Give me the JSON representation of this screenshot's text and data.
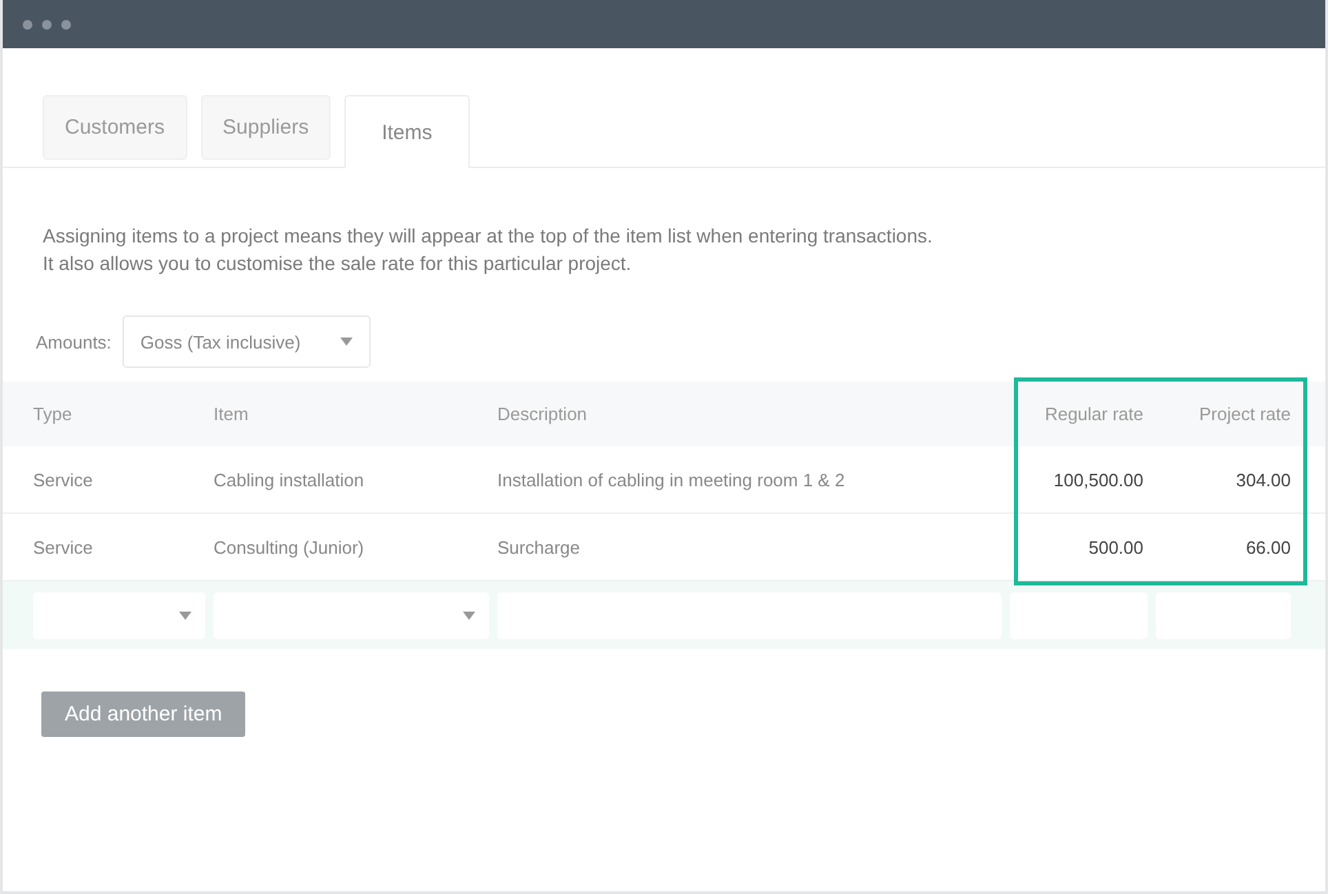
{
  "tabs": [
    {
      "label": "Customers",
      "selected": false
    },
    {
      "label": "Suppliers",
      "selected": false
    },
    {
      "label": "Items",
      "selected": true
    }
  ],
  "intro": [
    "Assigning items to a project means they will appear at the top of the item list when entering transactions.",
    "It also allows you to customise the sale rate for this particular project."
  ],
  "amounts": {
    "label": "Amounts:",
    "value": "Goss (Tax inclusive)"
  },
  "table": {
    "columns": [
      {
        "label": "Type",
        "kind": "select",
        "highlighted": false
      },
      {
        "label": "Item",
        "kind": "select",
        "highlighted": false
      },
      {
        "label": "Description",
        "kind": "text",
        "highlighted": false
      },
      {
        "label": "Regular rate",
        "kind": "amount",
        "highlighted": true
      },
      {
        "label": "Project rate",
        "kind": "amount",
        "highlighted": true
      }
    ],
    "rows": [
      [
        "Service",
        "Cabling installation",
        "Installation of cabling in meeting room 1 & 2",
        "100,500.00",
        "304.00"
      ],
      [
        "Service",
        "Consulting (Junior)",
        "Surcharge",
        "500.00",
        "66.00"
      ]
    ]
  },
  "add_button": "Add another item"
}
